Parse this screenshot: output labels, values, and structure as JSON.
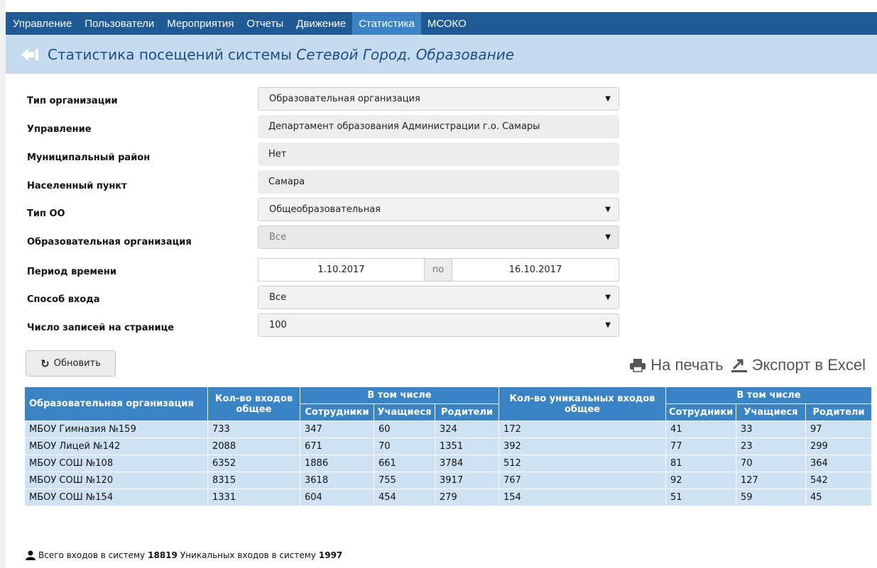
{
  "nav": {
    "items": [
      {
        "label": "Управление",
        "active": false
      },
      {
        "label": "Пользователи",
        "active": false
      },
      {
        "label": "Мероприятия",
        "active": false
      },
      {
        "label": "Отчеты",
        "active": false
      },
      {
        "label": "Движение",
        "active": false
      },
      {
        "label": "Статистика",
        "active": true
      },
      {
        "label": "МСОКО",
        "active": false
      }
    ]
  },
  "header": {
    "title_prefix": "Статистика посещений системы",
    "title_italic": "Сетевой Город. Образование",
    "back_icon": "back-arrow-icon"
  },
  "form": {
    "org_type": {
      "label": "Тип организации",
      "value": "Образовательная организация"
    },
    "management": {
      "label": "Управление",
      "value": "Департамент образования Администрации г.о. Самары"
    },
    "district": {
      "label": "Муниципальный район",
      "value": "Нет"
    },
    "locality": {
      "label": "Населенный пункт",
      "value": "Самара"
    },
    "oo_type": {
      "label": "Тип ОО",
      "value": "Общеобразовательная"
    },
    "edu_org": {
      "label": "Образовательная организация",
      "value": "Все"
    },
    "period": {
      "label": "Период времени",
      "from": "1.10.2017",
      "sep": "по",
      "to": "16.10.2017"
    },
    "login_method": {
      "label": "Способ входа",
      "value": "Все"
    },
    "page_size": {
      "label": "Число записей на странице",
      "value": "100"
    }
  },
  "toolbar": {
    "refresh_label": "Обновить",
    "print_label": "На печать",
    "export_label": "Экспорт в Excel"
  },
  "table": {
    "headers": {
      "org": "Образовательная организация",
      "total": "Кол-во входов общее",
      "incl1": "В том числе",
      "unique": "Кол-во уникальных входов общее",
      "incl2": "В том числе",
      "staff": "Сотрудники",
      "students": "Учащиеся",
      "parents": "Родители"
    },
    "rows": [
      [
        "МБОУ Гимназия №159",
        "733",
        "347",
        "60",
        "324",
        "172",
        "41",
        "33",
        "97"
      ],
      [
        "МБОУ Лицей №142",
        "2088",
        "671",
        "70",
        "1351",
        "392",
        "77",
        "23",
        "299"
      ],
      [
        "МБОУ СОШ №108",
        "6352",
        "1886",
        "661",
        "3784",
        "512",
        "81",
        "70",
        "364"
      ],
      [
        "МБОУ СОШ №120",
        "8315",
        "3618",
        "755",
        "3917",
        "767",
        "92",
        "127",
        "542"
      ],
      [
        "МБОУ СОШ №154",
        "1331",
        "604",
        "454",
        "279",
        "154",
        "51",
        "59",
        "45"
      ]
    ]
  },
  "summary": {
    "total_label": "Всего входов в систему",
    "total_value": "18819",
    "unique_label": "Уникальных входов в систему",
    "unique_value": "1997"
  },
  "colors": {
    "nav_bg": "#1f5a94",
    "nav_active": "#3a84c6",
    "title_bar": "#c7dbee",
    "table_header": "#3a84c6",
    "table_row": "#cfe2f3"
  }
}
